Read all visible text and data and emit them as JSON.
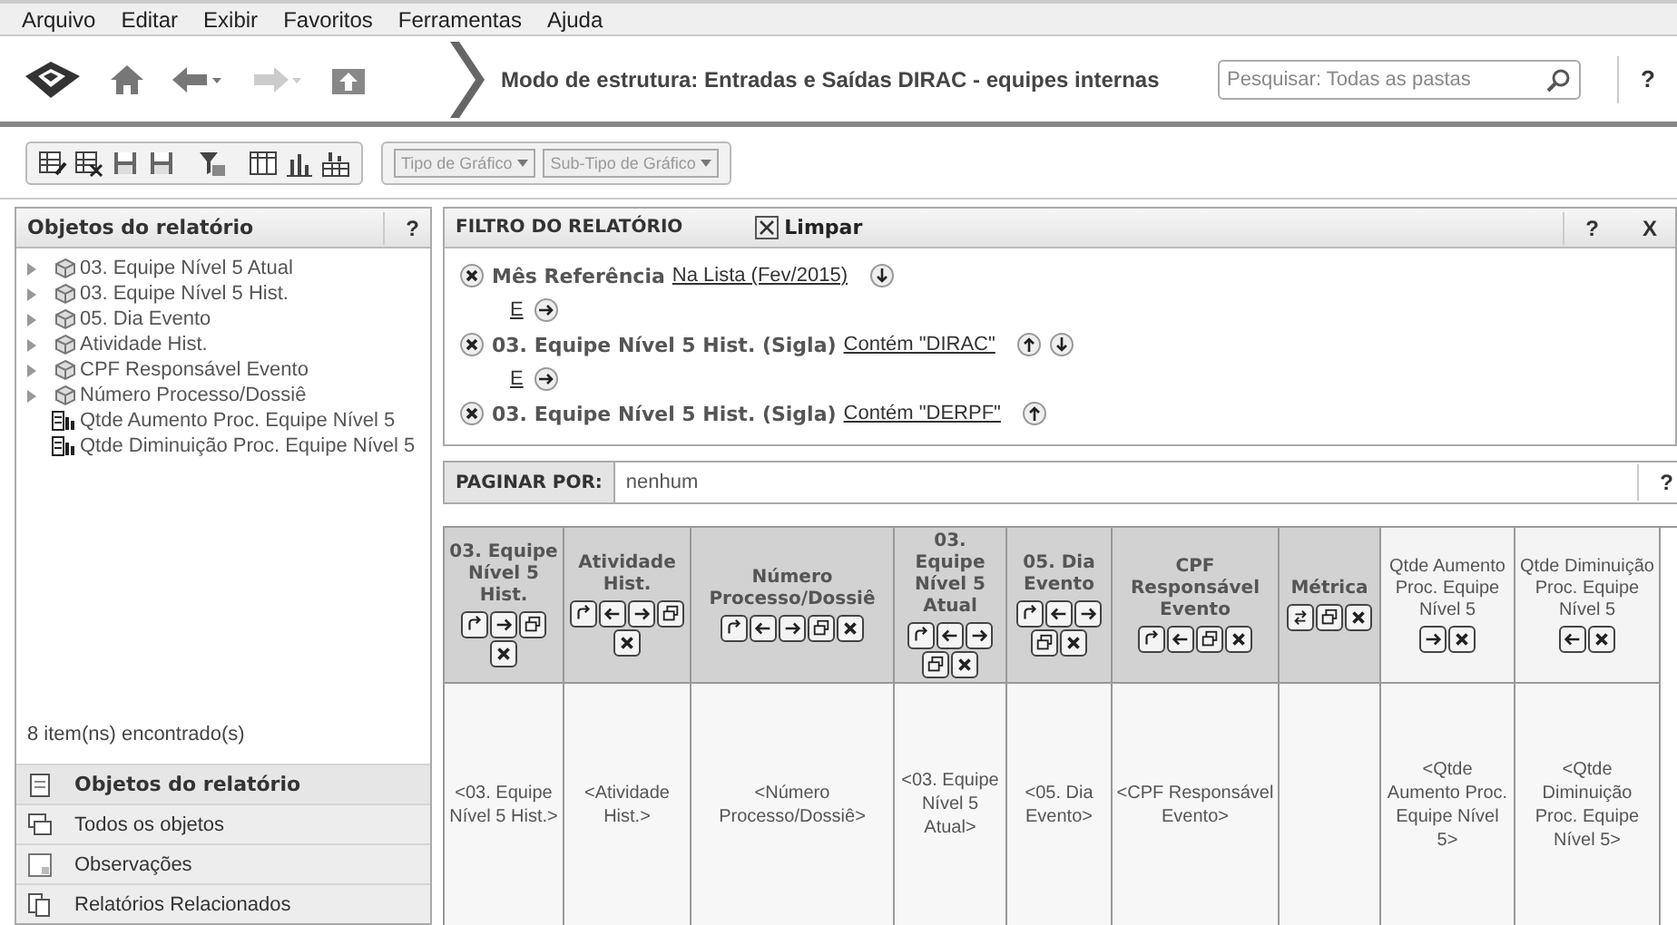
{
  "menu": [
    "Arquivo",
    "Editar",
    "Exibir",
    "Favoritos",
    "Ferramentas",
    "Ajuda"
  ],
  "nav": {
    "title": "Modo de estrutura: Entradas e Saídas DIRAC - equipes internas",
    "search": {
      "placeholder": "Pesquisar: Todas as pastas"
    },
    "help": "?",
    "forward_disabled": true
  },
  "toolbar": {
    "dropdowns": [
      "Tipo de Gráfico",
      "Sub-Tipo de Gráfico"
    ]
  },
  "objects_panel": {
    "title": "Objetos do relatório",
    "help": "?",
    "items": [
      {
        "kind": "dimension",
        "label": "03. Equipe Nível 5 Atual",
        "expanded": false
      },
      {
        "kind": "dimension",
        "label": "03. Equipe Nível 5 Hist.",
        "expanded": false
      },
      {
        "kind": "dimension",
        "label": "05. Dia Evento",
        "expanded": false
      },
      {
        "kind": "dimension",
        "label": "Atividade Hist.",
        "expanded": false
      },
      {
        "kind": "dimension",
        "label": "CPF Responsável Evento",
        "expanded": false
      },
      {
        "kind": "dimension",
        "label": "Número Processo/Dossiê",
        "expanded": false
      },
      {
        "kind": "metric",
        "label": "Qtde Aumento Proc. Equipe Nível 5"
      },
      {
        "kind": "metric",
        "label": "Qtde Diminuição Proc. Equipe Nível 5"
      }
    ],
    "count": "8 item(ns) encontrado(s)",
    "sections": [
      {
        "kind": "report",
        "label": "Objetos do relatório",
        "selected": true
      },
      {
        "kind": "all",
        "label": "Todos os objetos",
        "selected": false
      },
      {
        "kind": "notes",
        "label": "Observações",
        "selected": false
      },
      {
        "kind": "related",
        "label": "Relatórios Relacionados",
        "selected": false
      }
    ]
  },
  "filter": {
    "title": "FILTRO DO RELATÓRIO",
    "clear": "Limpar",
    "help": "?",
    "close": "X",
    "rows": [
      {
        "kind": "condition",
        "field": "Mês Referência",
        "operator": "Na Lista (Fev/2015)",
        "moves": [
          {
            "kind": "down"
          }
        ]
      },
      {
        "kind": "connector",
        "label": "E"
      },
      {
        "kind": "condition",
        "field": "03. Equipe Nível 5 Hist. (Sigla)",
        "operator": "Contém \"DIRAC\"",
        "moves": [
          {
            "kind": "up"
          },
          {
            "kind": "down"
          }
        ]
      },
      {
        "kind": "connector",
        "label": "E"
      },
      {
        "kind": "condition",
        "field": "03. Equipe Nível 5 Hist. (Sigla)",
        "operator": "Contém \"DERPF\"",
        "moves": [
          {
            "kind": "up"
          }
        ]
      }
    ]
  },
  "paging": {
    "label": "PAGINAR POR:",
    "value": "nenhum",
    "help": "?"
  },
  "table": {
    "columns": [
      {
        "kind": "attribute",
        "header": "03. Equipe Nível 5 Hist.",
        "controls": [
          {
            "kind": "pivot"
          },
          {
            "kind": "right"
          },
          {
            "kind": "page"
          },
          {
            "kind": "remove"
          }
        ],
        "cell": "<03. Equipe Nível 5 Hist.>"
      },
      {
        "kind": "attribute",
        "header": "Atividade Hist.",
        "controls": [
          {
            "kind": "pivot"
          },
          {
            "kind": "left"
          },
          {
            "kind": "right"
          },
          {
            "kind": "page"
          },
          {
            "kind": "remove"
          }
        ],
        "cell": "<Atividade Hist.>"
      },
      {
        "kind": "attribute",
        "header": "Número Processo/Dossiê",
        "controls": [
          {
            "kind": "pivot"
          },
          {
            "kind": "left"
          },
          {
            "kind": "right"
          },
          {
            "kind": "page"
          },
          {
            "kind": "remove"
          }
        ],
        "cell": "<Número Processo/Dossiê>"
      },
      {
        "kind": "attribute",
        "header": "03. Equipe Nível 5 Atual",
        "controls": [
          {
            "kind": "pivot"
          },
          {
            "kind": "left"
          },
          {
            "kind": "right"
          },
          {
            "kind": "page"
          },
          {
            "kind": "remove"
          }
        ],
        "cell": "<03. Equipe Nível 5 Atual>"
      },
      {
        "kind": "attribute",
        "header": "05. Dia Evento",
        "controls": [
          {
            "kind": "pivot"
          },
          {
            "kind": "left"
          },
          {
            "kind": "right"
          },
          {
            "kind": "page"
          },
          {
            "kind": "remove"
          }
        ],
        "cell": "<05. Dia Evento>"
      },
      {
        "kind": "attribute",
        "header": "CPF Responsável Evento",
        "controls": [
          {
            "kind": "pivot"
          },
          {
            "kind": "left"
          },
          {
            "kind": "page"
          },
          {
            "kind": "remove"
          }
        ],
        "cell": "<CPF Responsável Evento>"
      },
      {
        "kind": "attribute",
        "header": "Métrica",
        "controls": [
          {
            "kind": "swap"
          },
          {
            "kind": "page"
          },
          {
            "kind": "remove"
          }
        ]
      },
      {
        "kind": "metric",
        "header": "Qtde Aumento Proc. Equipe Nível 5",
        "controls": [
          {
            "kind": "right"
          },
          {
            "kind": "remove"
          }
        ],
        "cell": "<Qtde Aumento Proc. Equipe Nível 5>"
      },
      {
        "kind": "metric",
        "header": "Qtde Diminuição Proc. Equipe Nível 5",
        "controls": [
          {
            "kind": "left"
          },
          {
            "kind": "remove"
          }
        ],
        "cell": "<Qtde Diminuição Proc. Equipe Nível 5>"
      }
    ]
  }
}
